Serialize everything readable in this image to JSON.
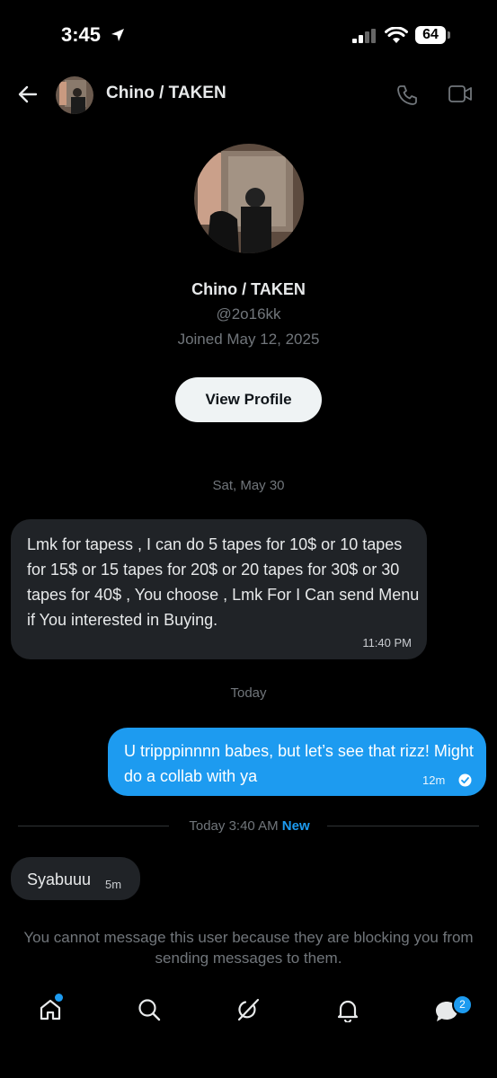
{
  "status_bar": {
    "time": "3:45",
    "battery": "64"
  },
  "header": {
    "name": "Chino / TAKEN"
  },
  "profile": {
    "name": "Chino / TAKEN",
    "handle": "@2o16kk",
    "joined": "Joined May 12, 2025",
    "view_profile_label": "View Profile"
  },
  "conversation": {
    "date_sep_1": "Sat, May 30",
    "msg1": {
      "text": "Lmk for tapess , I can do 5 tapes for 10$ or 10 tapes for 15$ or 15 tapes for 20$ or 20 tapes for 30$ or 30 tapes for 40$ , You choose , Lmk For I Can send Menu if You interested in Buying.",
      "time": "11:40 PM"
    },
    "date_sep_2": "Today",
    "msg2": {
      "text": "U tripppinnnn babes, but let’s see that rizz! Might do a collab with ya",
      "time": "12m"
    },
    "new_sep": {
      "time": "Today 3:40 AM",
      "new_label": "New"
    },
    "msg3": {
      "text": "Syabuuu",
      "time": "5m"
    },
    "blocked_notice": "You cannot message this user because they are blocking you from sending messages to them."
  },
  "tabbar": {
    "items": [
      "home-icon",
      "search-icon",
      "grok-icon",
      "notifications-icon",
      "messages-icon"
    ],
    "messages_badge": "2"
  },
  "colors": {
    "accent": "#1d9bf0",
    "bubble_in": "#202327",
    "muted": "#71767b"
  }
}
